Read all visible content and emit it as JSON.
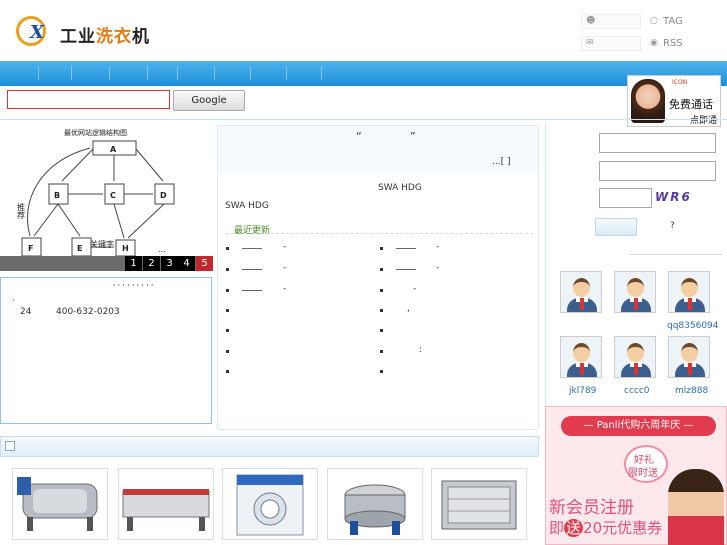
{
  "header": {
    "logo": {
      "letters": "X",
      "text_plain": "工业",
      "text_highlight": "洗衣",
      "text_tail": "机"
    },
    "tag_label": "TAG",
    "rss_label": "RSS"
  },
  "search": {
    "input_value": "",
    "button_label": "Google"
  },
  "call_widget": {
    "top_text": "ICON",
    "main_text": "免费通话",
    "sub_text": "一点即通"
  },
  "slideshow": {
    "diagram": {
      "title": "最优网站逻辑结构图",
      "nodes": [
        "A",
        "B",
        "C",
        "D",
        "F",
        "E",
        "H"
      ],
      "labels": [
        "推荐",
        "关键字"
      ],
      "ellipsis": "..."
    },
    "pages": [
      "1",
      "2",
      "3",
      "4",
      "5"
    ],
    "active_page": "5"
  },
  "left_info": {
    "dots": "' ' ' ' ' '   ' ' '",
    "comma": ",",
    "hours": "24",
    "phone": "400-632-0203"
  },
  "center": {
    "quote_open": "“",
    "quote_close": "”",
    "more_link": "...[  ]",
    "mid_title": "SWA HDG",
    "left_text": "SWA HDG",
    "recent_title": "最近更新",
    "list_left": [
      "-",
      "-",
      "-"
    ],
    "list_right": [
      "-",
      "-",
      "-",
      ",",
      ":"
    ]
  },
  "login": {
    "captcha_text": "WR6",
    "help": "?"
  },
  "users": [
    {
      "name": ""
    },
    {
      "name": ""
    },
    {
      "name": "qq8356094"
    },
    {
      "name": "jkl789"
    },
    {
      "name": "cccc0"
    },
    {
      "name": "mlz888"
    }
  ],
  "ad": {
    "banner": "— Panli代购六周年庆 —",
    "badge_line1": "好礼",
    "badge_line2": "限时送",
    "headline": "新会员注册",
    "subline_prefix": "即",
    "subline_highlight": "送",
    "subline_suffix": "20元优惠券"
  }
}
